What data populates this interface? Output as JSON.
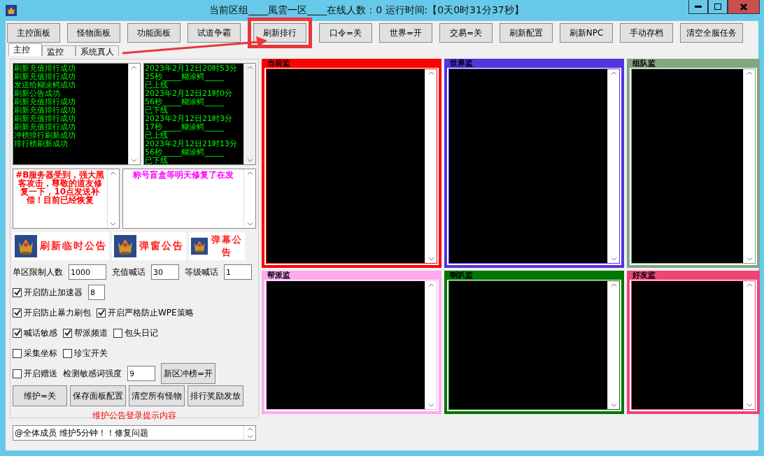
{
  "window": {
    "title": "当前区组____風雲一区____在线人数：0  运行时间:【0天0时31分37秒】"
  },
  "toolbar": [
    {
      "label": "主控面板",
      "annotated": false
    },
    {
      "label": "怪物面板",
      "annotated": false
    },
    {
      "label": "功能面板",
      "annotated": false
    },
    {
      "label": "试道争霸",
      "annotated": false
    },
    {
      "label": "刷新排行",
      "annotated": true
    },
    {
      "label": "口令=关",
      "annotated": false
    },
    {
      "label": "世界=开",
      "annotated": false
    },
    {
      "label": "交易=关",
      "annotated": false
    },
    {
      "label": "刷新配置",
      "annotated": false
    },
    {
      "label": "刷新NPC",
      "annotated": false
    },
    {
      "label": "手动存档",
      "annotated": false
    },
    {
      "label": "清空全服任务",
      "annotated": false
    }
  ],
  "tabs": [
    {
      "label": "主控",
      "selected": true
    },
    {
      "label": "监控",
      "selected": false
    },
    {
      "label": "系统真人",
      "selected": false
    }
  ],
  "log": [
    "刷新充值排行成功",
    "刷新充值排行成功",
    "发送给糊涂鳄成功",
    "刷新公告成功",
    "刷新充值排行成功",
    "刷新充值排行成功",
    "刷新充值排行成功",
    "刷新充值排行成功",
    "冲榜排行刷新成功",
    "排行榜刷新成功"
  ],
  "login_log": [
    "2023年2月12日20时53分",
    "25秒_____糊涂鳄_____",
    "已上线",
    "2023年2月12日21时0分",
    "56秒_____糊涂鳄_____",
    "已下线",
    "2023年2月12日21时3分",
    "17秒_____糊涂鳄_____",
    "已上线",
    "2023年2月12日21时13分",
    "56秒_____糊涂鳄_____",
    "已下线"
  ],
  "notices": [
    {
      "text": "#B服务器受到，强大黑客攻击，尊敬的道友修复一下，10点发送补偿！目前已经恢复",
      "color": "#ff0000"
    },
    {
      "text": "称号盲盒等明天修复了在发",
      "color": "#ff00ff"
    }
  ],
  "banners": [
    "刷新临时公告",
    "弹窗公告",
    "弹幕公告"
  ],
  "form_rows": [
    [
      {
        "kind": "field",
        "label": "单区限制人数",
        "value": "1000"
      },
      {
        "kind": "field",
        "label": "充值喊话",
        "value": "30"
      },
      {
        "kind": "field",
        "label": "等级喊话",
        "value": "1"
      }
    ],
    [
      {
        "kind": "checkbox",
        "label": "开启防止加速器",
        "checked": true
      },
      {
        "kind": "field",
        "value": "8"
      }
    ],
    [
      {
        "kind": "checkbox",
        "label": "开启防止暴力刷包",
        "checked": true
      },
      {
        "kind": "checkbox",
        "label": "开启严格防止WPE策略",
        "checked": true
      }
    ],
    [
      {
        "kind": "checkbox",
        "label": "喊话敏感",
        "checked": true
      },
      {
        "kind": "checkbox",
        "label": "帮派频道",
        "checked": true
      },
      {
        "kind": "checkbox",
        "label": "包头日记",
        "checked": false
      }
    ],
    [
      {
        "kind": "checkbox",
        "label": "采集坐标",
        "checked": false
      },
      {
        "kind": "checkbox",
        "label": "珍宝开关",
        "checked": false
      }
    ],
    [
      {
        "kind": "checkbox",
        "label": "开启赠送",
        "checked": false
      },
      {
        "kind": "field",
        "label": "检测敏感词强度",
        "value": "9"
      },
      {
        "kind": "button",
        "label": "新区冲榜=开"
      }
    ]
  ],
  "actions": [
    "维护=关",
    "保存面板配置",
    "清空所有怪物",
    "排行奖励发放"
  ],
  "maintenance": {
    "label": "维护公告登录提示内容",
    "message": "@全体成员 维护5分钟！！修复问题"
  },
  "monitors": [
    {
      "title": "当前监",
      "color": "#ff0000"
    },
    {
      "title": "世界监",
      "color": "#5533dd"
    },
    {
      "title": "组队监",
      "color": "#82a582"
    },
    {
      "title": "帮派监",
      "color": "#ffaaee"
    },
    {
      "title": "喇叭监",
      "color": "#007700"
    },
    {
      "title": "好友监",
      "color": "#ee4477"
    }
  ]
}
